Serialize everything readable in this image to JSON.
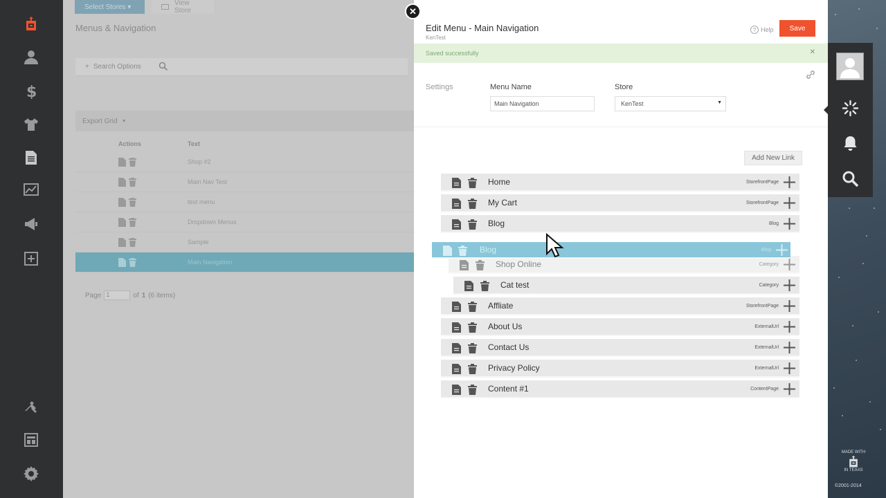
{
  "background_page": {
    "top_buttons": [
      "Select Stores ▾",
      "View Store"
    ],
    "title": "Menus & Navigation",
    "search_label": "Search Options",
    "export_label": "Export Grid",
    "grid_headers": {
      "actions": "Actions",
      "text": "Text"
    },
    "rows": [
      "Shop #2",
      "Main Nav Test",
      "test menu",
      "Dropdown Menus",
      "Sample",
      "Main Navigation"
    ],
    "pager": {
      "page_label": "Page",
      "page_value": "1",
      "of_text": "of",
      "total_pages": "1",
      "items_text": "(6 items)"
    }
  },
  "panel": {
    "title": "Edit Menu - Main Navigation",
    "subtitle": "KenTest",
    "help_label": "Help",
    "save_label": "Save",
    "alert_message": "Saved successfully",
    "settings_label": "Settings",
    "menu_name_label": "Menu Name",
    "menu_name_value": "Main Navigation",
    "store_label": "Store",
    "store_value": "KenTest",
    "add_link_label": "Add New Link"
  },
  "menu_items": [
    {
      "label": "Home",
      "type": "StorefrontPage"
    },
    {
      "label": "My Cart",
      "type": "StorefrontPage"
    },
    {
      "label": "Blog",
      "type": "Blog"
    },
    {
      "label": "Shop Online",
      "type": "Category"
    },
    {
      "label": "Cat test",
      "type": "Category"
    },
    {
      "label": "Affliate",
      "type": "StorefrontPage"
    },
    {
      "label": "About Us",
      "type": "ExternalUrl"
    },
    {
      "label": "Contact Us",
      "type": "ExternalUrl"
    },
    {
      "label": "Privacy Policy",
      "type": "ExternalUrl"
    },
    {
      "label": "Content #1",
      "type": "ContentPage"
    }
  ],
  "dragging_item": {
    "label": "Blog",
    "type": "Blog"
  },
  "right_sidebar": {
    "badge_text_top": "MADE WITH",
    "badge_text_bottom": "IN TEXAS",
    "copyright": "©2001-2014"
  },
  "colors": {
    "accent": "#f0522d",
    "drag_highlight": "#7fc2d6",
    "selected_row": "#6fa8b6"
  }
}
